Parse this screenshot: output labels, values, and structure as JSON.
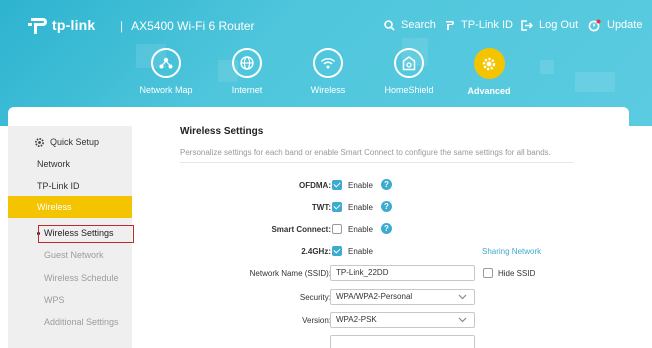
{
  "brand": {
    "logo_text": "tp-link",
    "separator": "|",
    "model": "AX5400 Wi-Fi 6 Router"
  },
  "top_nav": {
    "search": "Search",
    "tplink_id": "TP-Link ID",
    "logout": "Log Out",
    "update": "Update"
  },
  "main_nav": [
    {
      "label": "Network Map",
      "icon": "network-map-icon"
    },
    {
      "label": "Internet",
      "icon": "globe-icon"
    },
    {
      "label": "Wireless",
      "icon": "wifi-icon"
    },
    {
      "label": "HomeShield",
      "icon": "homeshield-icon"
    },
    {
      "label": "Advanced",
      "icon": "gear-icon",
      "active": true
    }
  ],
  "sidebar": {
    "quick_setup": "Quick Setup",
    "items": [
      "Network",
      "TP-Link ID",
      "Wireless"
    ],
    "active_item": "Wireless",
    "subitems": [
      "Wireless Settings",
      "Guest Network",
      "Wireless Schedule",
      "WPS",
      "Additional Settings"
    ],
    "active_subitem": "Wireless Settings"
  },
  "main": {
    "title": "Wireless Settings",
    "subtitle": "Personalize settings for each band or enable Smart Connect to configure the same settings for all bands.",
    "ofdma": {
      "label": "OFDMA:",
      "option": "Enable",
      "checked": true
    },
    "twt": {
      "label": "TWT:",
      "option": "Enable",
      "checked": true
    },
    "smart_connect": {
      "label": "Smart Connect:",
      "option": "Enable",
      "checked": false
    },
    "band": {
      "label": "2.4GHz:",
      "option": "Enable",
      "checked": true,
      "link": "Sharing Network"
    },
    "ssid": {
      "label": "Network Name (SSID):",
      "value": "TP-Link_22DD",
      "hide_label": "Hide SSID",
      "hide_checked": false
    },
    "security": {
      "label": "Security:",
      "value": "WPA/WPA2-Personal"
    },
    "version": {
      "label": "Version:",
      "value": "WPA2-PSK"
    }
  },
  "colors": {
    "header": "#4fc6dc",
    "accent": "#f5c400",
    "link": "#3cabd0",
    "selection_box": "#c0282f"
  }
}
